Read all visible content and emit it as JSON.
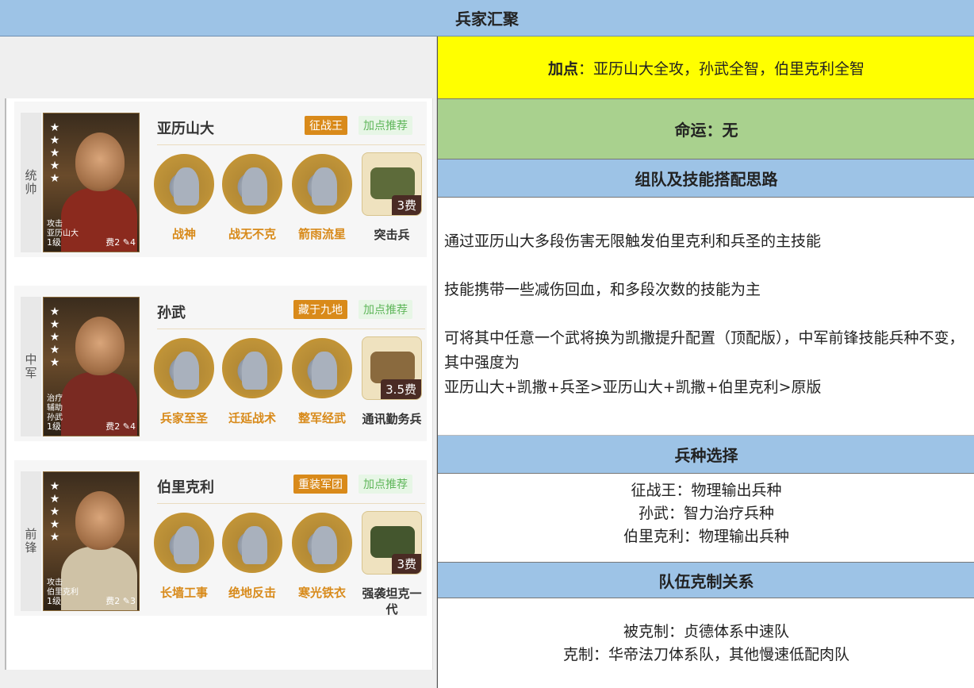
{
  "header": {
    "title": "兵家汇聚"
  },
  "right": {
    "points": {
      "label": "加点",
      "sep": "：",
      "text": "亚历山大全攻，孙武全智，伯里克利全智"
    },
    "fate": "命运：无",
    "section_strategy": "组队及技能搭配思路",
    "strategy_lines": [
      "通过亚历山大多段伤害无限触发伯里克利和兵圣的主技能",
      "技能携带一些减伤回血，和多段次数的技能为主",
      "可将其中任意一个武将换为凯撒提升配置（顶配版），中军前锋技能兵种不变，其中强度为",
      "亚历山大+凯撒+兵圣>亚历山大+凯撒+伯里克利>原版"
    ],
    "section_troops": "兵种选择",
    "troop_lines": [
      "征战王：物理输出兵种",
      "孙武：智力治疗兵种",
      "伯里克利：物理输出兵种"
    ],
    "section_counter": "队伍克制关系",
    "counter_lines": [
      "被克制：贞德体系中速队",
      "克制：华帝法刀体系队，其他慢速低配肉队"
    ]
  },
  "cards": [
    {
      "role": "统帅",
      "name": "亚历山大",
      "tag": "征战王",
      "tag2": "加点推荐",
      "portrait_label1": "攻击",
      "portrait_label2": "亚历山大",
      "level": "1级",
      "cost": "费2",
      "cost2": "4",
      "stars": "★★★★★",
      "skills": [
        "战神",
        "战无不克",
        "箭雨流星"
      ],
      "unit_name": "突击兵",
      "unit_cost": "3费"
    },
    {
      "role": "中军",
      "name": "孙武",
      "tag": "藏于九地",
      "tag2": "加点推荐",
      "portrait_label1": "治疗",
      "portrait_label2": "辅助",
      "portrait_label3": "孙武",
      "level": "1级",
      "cost": "费2",
      "cost2": "4",
      "stars": "★★★★★",
      "skills": [
        "兵家至圣",
        "迁延战术",
        "整军经武"
      ],
      "unit_name": "通讯勤务兵",
      "unit_cost": "3.5费"
    },
    {
      "role": "前锋",
      "name": "伯里克利",
      "tag": "重装军团",
      "tag2": "加点推荐",
      "portrait_label1": "攻击",
      "portrait_label2": "伯里克利",
      "level": "1级",
      "cost": "费2",
      "cost2": "3",
      "stars": "★★★★★",
      "skills": [
        "长墙工事",
        "绝地反击",
        "寒光铁衣"
      ],
      "unit_name": "强袭坦克一代",
      "unit_cost": "3费"
    }
  ],
  "colors": {
    "header_blue": "#9dc3e6",
    "yellow": "#ffff00",
    "green": "#a9d18e",
    "tag_orange": "#d98a1a",
    "tag_green": "#5fb65a"
  }
}
